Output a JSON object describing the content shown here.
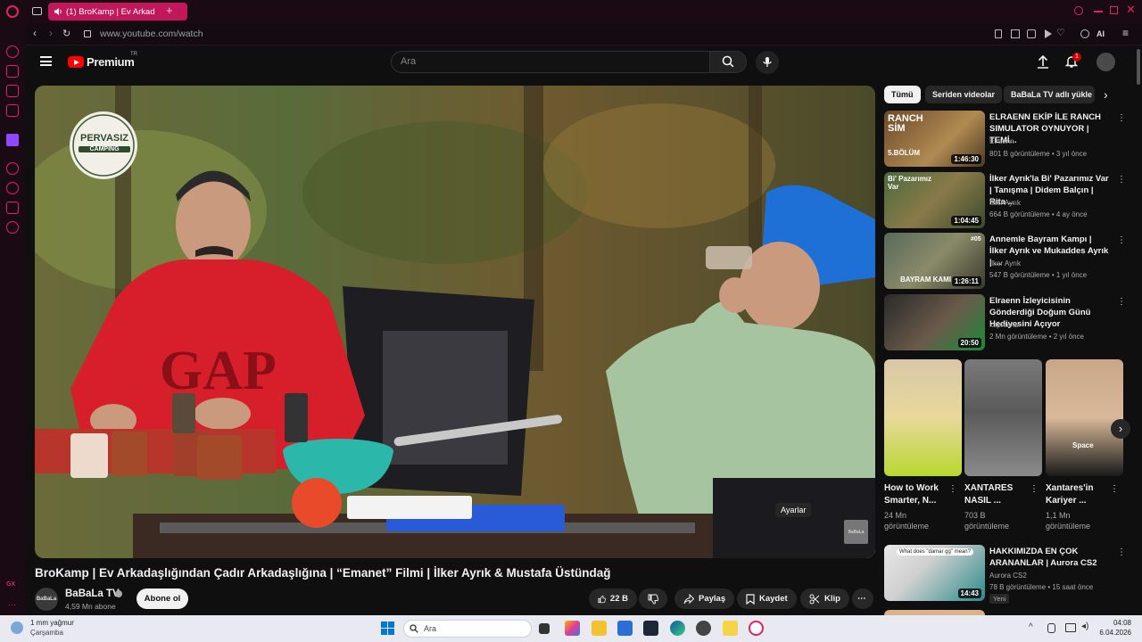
{
  "browser": {
    "tab_title": "(1) BroKamp | Ev Arkad",
    "url": "www.youtube.com/watch",
    "ai_label": "AI"
  },
  "masthead": {
    "logo_text": "Premium",
    "logo_sup": "TR",
    "search_placeholder": "Ara",
    "notification_count": "1"
  },
  "player": {
    "brand_top": "PERVASIZ",
    "brand_bottom": "CAMPING",
    "tooltip": "Ayarlar",
    "corner_logo": "BaBaLa"
  },
  "video": {
    "title": "BroKamp | Ev Arkadaşlığından Çadır Arkadaşlığına | “Emanet” Filmi | İlker Ayrık & Mustafa Üstündağ",
    "channel": "BaBaLa TV",
    "channel_avatar": "BaBaLa",
    "subscribers": "4,59 Mn abone",
    "subscribe_label": "Abone ol",
    "likes": "22 B",
    "share_label": "Paylaş",
    "save_label": "Kaydet",
    "clip_label": "Klip"
  },
  "chips": [
    "Tümü",
    "Seriden videolar",
    "BaBaLa TV adlı yükle"
  ],
  "recommendations": [
    {
      "title": "ELRAENN EKİP İLE RANCH SIMULATOR OYNUYOR | TEMİ...",
      "channel": "Elraenn",
      "meta": "801 B görüntüleme • 3 yıl önce",
      "duration": "1:46:30",
      "thumb_text": "RANCH SİM",
      "thumb_sub": "5.BÖLÜM"
    },
    {
      "title": "İlker Ayrık'la Bi' Pazarımız Var | Tanışma | Didem Balçın | Rita ...",
      "channel": "İlker Ayrık",
      "meta": "664 B görüntüleme • 4 ay önce",
      "duration": "1:04:45",
      "thumb_text": "Bi' Pazarımız Var"
    },
    {
      "title": "Annemle Bayram Kampı | İlker Ayrık ve Mukaddes Ayrık | ...",
      "channel": "İlker Ayrık",
      "meta": "547 B görüntüleme • 1 yıl önce",
      "duration": "1:26:11",
      "thumb_text": "BAYRAM KAMI",
      "thumb_sub": "#05"
    },
    {
      "title": "Elraenn İzleyicisinin Gönderdiği Doğum Günü Hediyesini Açıyor",
      "channel": "kaphtans",
      "meta": "2 Mn görüntüleme • 2 yıl önce",
      "duration": "20:50"
    },
    {
      "title": "HAKKIMIZDA EN ÇOK ARANANLAR | Aurora CS2",
      "channel": "Aurora CS2",
      "meta": "78 B görüntüleme • 15 saat önce",
      "duration": "14:43",
      "badge": "Yeni",
      "thumb_text": "What does \"damar gg\" mean?"
    }
  ],
  "shorts": [
    {
      "title": "How to Work Smarter, N...",
      "views": "24 Mn görüntüleme"
    },
    {
      "title": "XANTARES NASIL ...",
      "views": "703 B görüntüleme"
    },
    {
      "title": "Xantares'in Kariyer ...",
      "views": "1,1 Mn görüntüleme",
      "thumb_text": "Space"
    }
  ],
  "taskbar": {
    "weather": "1 mm yağmur",
    "weather_day": "Çarşamba",
    "search_placeholder": "Ara",
    "time": "04:08",
    "date": "6.04.2026"
  },
  "rail": {
    "bottom_label": "GX"
  }
}
